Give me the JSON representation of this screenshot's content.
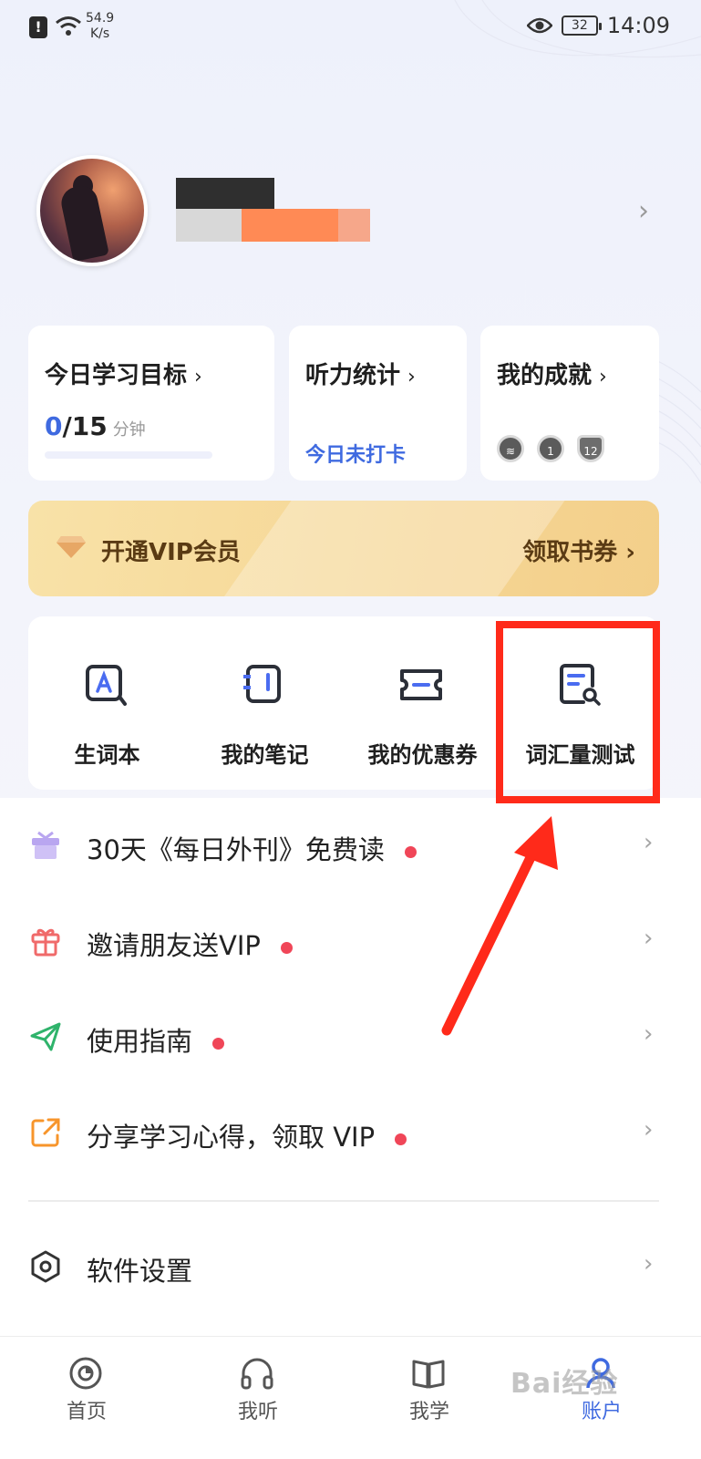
{
  "status_bar": {
    "net_speed_value": "54.9",
    "net_speed_unit": "K/s",
    "battery": "32",
    "time": "14:09"
  },
  "stats": {
    "goal": {
      "title": "今日学习目标",
      "current": "0",
      "separator": "/",
      "target": "15",
      "unit": "分钟",
      "progress": 0.0
    },
    "listening": {
      "title": "听力统计",
      "status": "今日未打卡"
    },
    "achievements": {
      "title": "我的成就",
      "badges": [
        "1",
        "12"
      ]
    }
  },
  "vip": {
    "label": "开通VIP会员",
    "action": "领取书券"
  },
  "shortcuts": [
    {
      "label": "生词本",
      "icon": "vocabulary-book-icon"
    },
    {
      "label": "我的笔记",
      "icon": "notes-icon"
    },
    {
      "label": "我的优惠券",
      "icon": "coupon-icon"
    },
    {
      "label": "词汇量测试",
      "icon": "vocab-test-icon"
    }
  ],
  "list": [
    {
      "label": "30天《每日外刊》免费读",
      "icon": "gift-box-icon",
      "icon_color": "#b9a6f0",
      "dot": true
    },
    {
      "label": "邀请朋友送VIP",
      "icon": "gift-icon",
      "icon_color": "#f06a6a",
      "dot": true
    },
    {
      "label": "使用指南",
      "icon": "paper-plane-icon",
      "icon_color": "#2fb36b",
      "dot": true
    },
    {
      "label": "分享学习心得，领取 VIP",
      "icon": "share-icon",
      "icon_color": "#f7952b",
      "dot": true
    },
    {
      "label": "软件设置",
      "icon": "settings-icon",
      "icon_color": "#333333",
      "dot": false
    }
  ],
  "bottom_nav": [
    {
      "label": "首页",
      "icon": "home-icon",
      "active": false
    },
    {
      "label": "我听",
      "icon": "headphones-icon",
      "active": false
    },
    {
      "label": "我学",
      "icon": "book-icon",
      "active": false
    },
    {
      "label": "账户",
      "icon": "account-icon",
      "active": true
    }
  ],
  "watermark": "Bai经验",
  "colors": {
    "accent": "#3f6ae0",
    "highlight": "#ff2a1a",
    "dot": "#f04658"
  }
}
